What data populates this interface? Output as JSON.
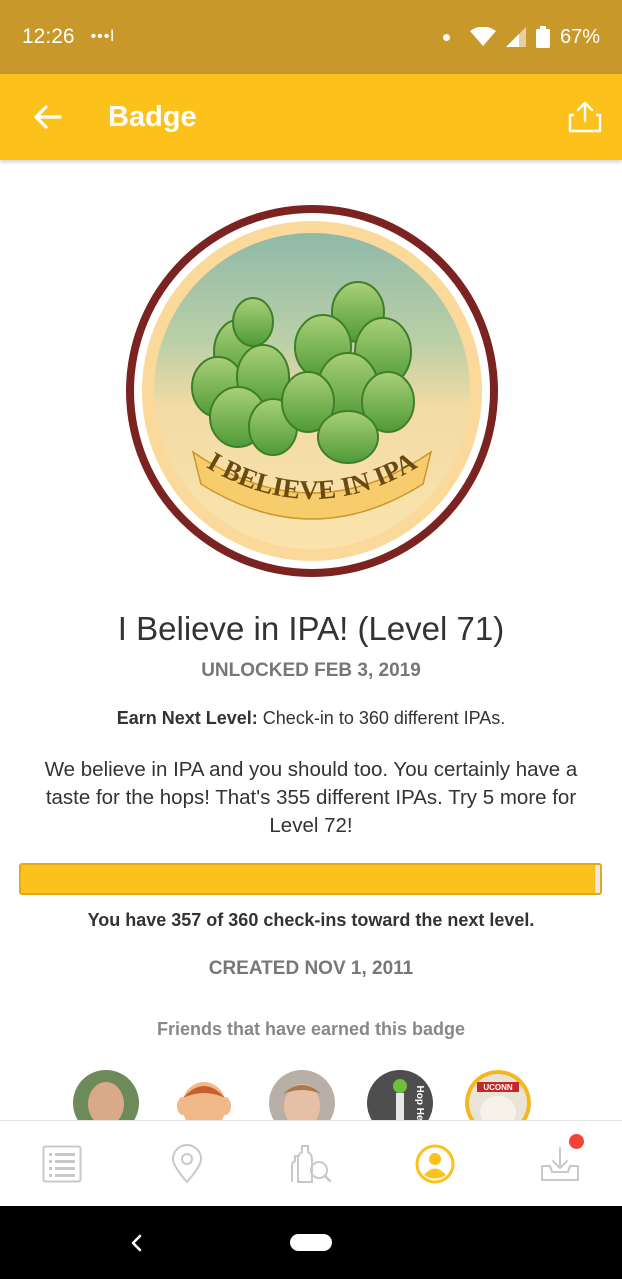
{
  "status_bar": {
    "time": "12:26",
    "signal_dots": "•••l",
    "battery": "67%"
  },
  "app_bar": {
    "title": "Badge",
    "back_icon": "arrow-left-icon",
    "share_icon": "share-icon"
  },
  "badge": {
    "image_text": "I BELIEVE IN IPA",
    "title": "I Believe in IPA! (Level 71)",
    "unlocked": "UNLOCKED FEB 3, 2019",
    "earn_label": "Earn Next Level:",
    "earn_text": " Check-in to 360 different IPAs.",
    "description": "We believe in IPA and you should too. You certainly have a taste for the hops! That's 355 different IPAs. Try 5 more for Level 72!",
    "progress_fraction": 0.9917,
    "progress_text": "You have 357 of 360 check-ins toward the next level.",
    "created": "CREATED NOV 1, 2011"
  },
  "friends": {
    "heading": "Friends that have earned this badge",
    "avatars": [
      {
        "name": "friend-avatar-1"
      },
      {
        "name": "friend-avatar-2"
      },
      {
        "name": "friend-avatar-3"
      },
      {
        "name": "friend-avatar-4",
        "text": "Hop He"
      },
      {
        "name": "friend-avatar-5",
        "text": "UCONN"
      }
    ]
  },
  "bottom_nav": {
    "items": [
      "feed-icon",
      "location-icon",
      "recommendations-icon",
      "profile-icon",
      "download-icon"
    ],
    "active": "profile-icon",
    "active_color": "#fcc21b"
  },
  "colors": {
    "status_bar": "#c8982b",
    "app_bar": "#fcc21b",
    "badge_ring": "#7a2320"
  }
}
